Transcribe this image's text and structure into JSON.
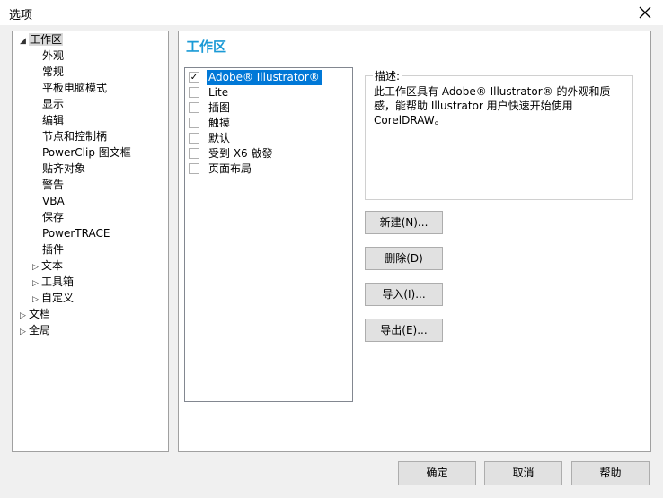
{
  "window": {
    "title": "选项",
    "close_label": "×"
  },
  "tree": {
    "items": [
      {
        "label": "工作区",
        "arrow": "◢",
        "selected": true
      },
      {
        "label": "外观"
      },
      {
        "label": "常规"
      },
      {
        "label": "平板电脑模式"
      },
      {
        "label": "显示"
      },
      {
        "label": "编辑"
      },
      {
        "label": "节点和控制柄"
      },
      {
        "label": "PowerClip 图文框"
      },
      {
        "label": "贴齐对象"
      },
      {
        "label": "警告"
      },
      {
        "label": "VBA"
      },
      {
        "label": "保存"
      },
      {
        "label": "PowerTRACE"
      },
      {
        "label": "插件"
      },
      {
        "label": "文本",
        "arrow": "▷"
      },
      {
        "label": "工具箱",
        "arrow": "▷"
      },
      {
        "label": "自定义",
        "arrow": "▷"
      },
      {
        "label": "文档",
        "arrow": "▷"
      },
      {
        "label": "全局",
        "arrow": "▷"
      }
    ]
  },
  "panel": {
    "title": "工作区",
    "workspaces": [
      {
        "label": "Adobe® Illustrator®",
        "checked": true,
        "selected": true
      },
      {
        "label": "Lite",
        "checked": false
      },
      {
        "label": "插图",
        "checked": false
      },
      {
        "label": "触摸",
        "checked": false
      },
      {
        "label": "默认",
        "checked": false
      },
      {
        "label": "受到 X6 啟發",
        "checked": false
      },
      {
        "label": "页面布局",
        "checked": false
      }
    ],
    "check_mark": "✓",
    "description": {
      "legend": "描述:",
      "text": "此工作区具有 Adobe® Illustrator® 的外观和质感，能帮助 Illustrator 用户快速开始使用 CorelDRAW。"
    },
    "buttons": {
      "new": "新建(N)...",
      "delete": "删除(D)",
      "import": "导入(I)...",
      "export": "导出(E)..."
    }
  },
  "footer": {
    "ok": "确定",
    "cancel": "取消",
    "help": "帮助"
  }
}
